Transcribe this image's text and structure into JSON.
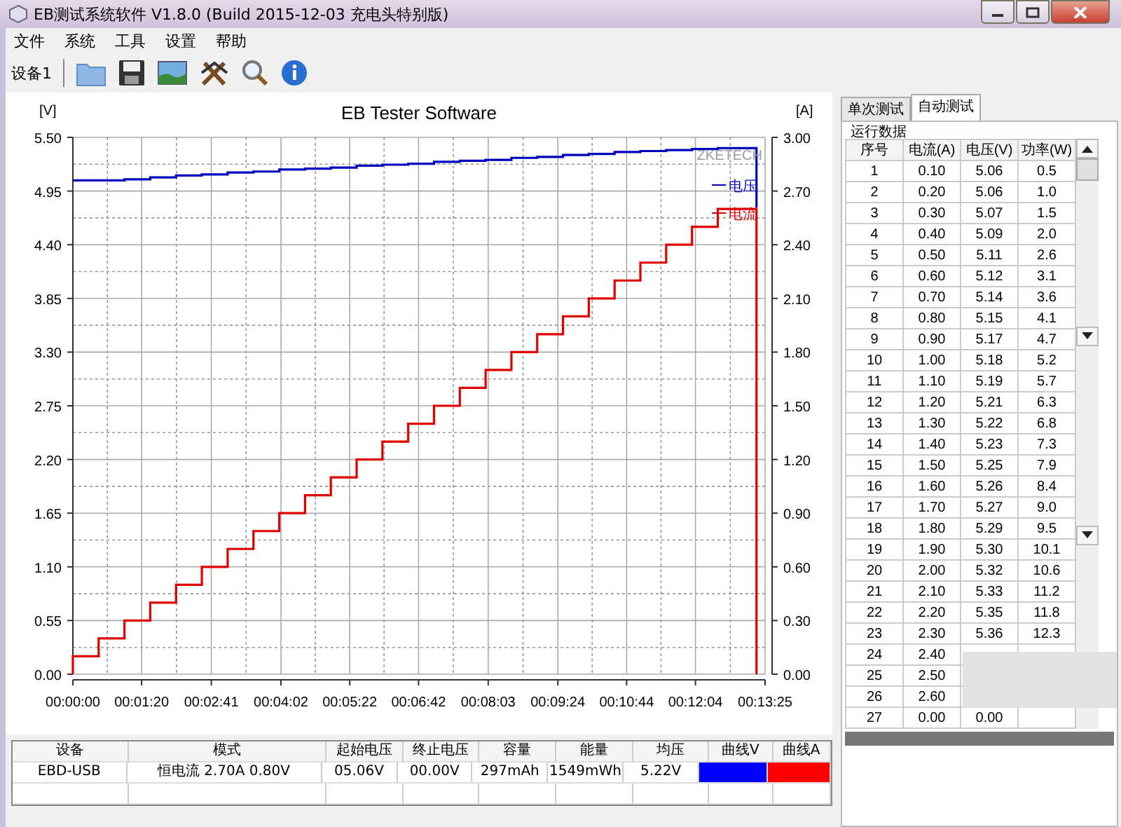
{
  "window": {
    "title": "EB测试系统软件 V1.8.0 (Build 2015-12-03 充电头特别版)"
  },
  "menu": [
    "文件",
    "系统",
    "工具",
    "设置",
    "帮助"
  ],
  "toolbar": {
    "device_label": "设备1"
  },
  "chart": {
    "chart_data": {
      "type": "line",
      "title": "EB Tester Software",
      "ylabel": "[V]",
      "y2label": "[A]",
      "annotations": [
        {
          "text": "ZKETECH"
        }
      ],
      "grid": true,
      "legend": "upper right",
      "x": [
        0,
        0,
        30,
        30,
        60,
        60,
        90,
        90,
        120,
        120,
        150,
        150,
        180,
        180,
        210,
        210,
        240,
        240,
        270,
        270,
        300,
        300,
        330,
        330,
        360,
        360,
        390,
        390,
        420,
        420,
        450,
        450,
        480,
        480,
        510,
        510,
        540,
        540,
        570,
        570,
        600,
        600,
        630,
        630,
        660,
        660,
        690,
        690,
        720,
        720,
        750,
        750,
        795,
        795
      ],
      "series": [
        {
          "name": "电压",
          "color": "#0000c0",
          "values": [
            5.06,
            5.06,
            5.06,
            5.06,
            5.06,
            5.07,
            5.07,
            5.09,
            5.09,
            5.11,
            5.11,
            5.12,
            5.12,
            5.14,
            5.14,
            5.15,
            5.15,
            5.17,
            5.17,
            5.18,
            5.18,
            5.19,
            5.19,
            5.21,
            5.21,
            5.22,
            5.22,
            5.23,
            5.23,
            5.25,
            5.25,
            5.26,
            5.26,
            5.27,
            5.27,
            5.29,
            5.29,
            5.3,
            5.3,
            5.32,
            5.32,
            5.33,
            5.33,
            5.35,
            5.35,
            5.36,
            5.36,
            5.37,
            5.37,
            5.38,
            5.38,
            5.39,
            5.39,
            4.78
          ]
        },
        {
          "name": "电流",
          "color": "#e00000",
          "axis": "y2",
          "values": [
            0,
            0.1,
            0.1,
            0.2,
            0.2,
            0.3,
            0.3,
            0.4,
            0.4,
            0.5,
            0.5,
            0.6,
            0.6,
            0.7,
            0.7,
            0.8,
            0.8,
            0.9,
            0.9,
            1.0,
            1.0,
            1.1,
            1.1,
            1.2,
            1.2,
            1.3,
            1.3,
            1.4,
            1.4,
            1.5,
            1.5,
            1.6,
            1.6,
            1.7,
            1.7,
            1.8,
            1.8,
            1.9,
            1.9,
            2.0,
            2.0,
            2.1,
            2.1,
            2.2,
            2.2,
            2.3,
            2.3,
            2.4,
            2.4,
            2.5,
            2.5,
            2.6,
            2.6,
            0
          ]
        }
      ],
      "xlim": [
        0,
        805
      ],
      "ylim": [
        0,
        5.5
      ],
      "y2lim": [
        0,
        3
      ],
      "xticks": [
        {
          "value": 0,
          "label": "00:00:00"
        },
        {
          "value": 80,
          "label": "00:01:20"
        },
        {
          "value": 161,
          "label": "00:02:41"
        },
        {
          "value": 242,
          "label": "00:04:02"
        },
        {
          "value": 322,
          "label": "00:05:22"
        },
        {
          "value": 402,
          "label": "00:06:42"
        },
        {
          "value": 483,
          "label": "00:08:03"
        },
        {
          "value": 564,
          "label": "00:09:24"
        },
        {
          "value": 644,
          "label": "00:10:44"
        },
        {
          "value": 724,
          "label": "00:12:04"
        },
        {
          "value": 805,
          "label": "00:13:25"
        }
      ],
      "yticks": [
        {
          "value": 0,
          "label": "0.00"
        },
        {
          "value": 0.55,
          "label": "0.55"
        },
        {
          "value": 1.1,
          "label": "1.10"
        },
        {
          "value": 1.65,
          "label": "1.65"
        },
        {
          "value": 2.2,
          "label": "2.20"
        },
        {
          "value": 2.75,
          "label": "2.75"
        },
        {
          "value": 3.3,
          "label": "3.30"
        },
        {
          "value": 3.85,
          "label": "3.85"
        },
        {
          "value": 4.4,
          "label": "4.40"
        },
        {
          "value": 4.95,
          "label": "4.95"
        },
        {
          "value": 5.5,
          "label": "5.50"
        }
      ],
      "y2ticks": [
        {
          "value": 0,
          "label": "0.00"
        },
        {
          "value": 0.3,
          "label": "0.30"
        },
        {
          "value": 0.6,
          "label": "0.60"
        },
        {
          "value": 0.9,
          "label": "0.90"
        },
        {
          "value": 1.2,
          "label": "1.20"
        },
        {
          "value": 1.5,
          "label": "1.50"
        },
        {
          "value": 1.8,
          "label": "1.80"
        },
        {
          "value": 2.1,
          "label": "2.10"
        },
        {
          "value": 2.4,
          "label": "2.40"
        },
        {
          "value": 2.7,
          "label": "2.70"
        },
        {
          "value": 3.0,
          "label": "3.00"
        }
      ]
    }
  },
  "summary": {
    "columns": [
      "设备",
      "模式",
      "起始电压",
      "终止电压",
      "容量",
      "能量",
      "均压",
      "曲线V",
      "曲线A"
    ],
    "row": {
      "device": "EBD-USB",
      "mode": "恒电流  2.70A  0.80V",
      "start_voltage": "05.06V",
      "end_voltage": "00.00V",
      "capacity": "297mAh",
      "energy": "1549mWh",
      "avg_voltage": "5.22V"
    },
    "curves": [
      {
        "color": "#0000ff"
      },
      {
        "color": "#ff0000"
      }
    ]
  },
  "side_panel": {
    "tabs": [
      {
        "label": "单次测试",
        "selected": false
      },
      {
        "label": "自动测试",
        "selected": true
      }
    ],
    "group_title": "运行数据",
    "columns": [
      "序号",
      "电流(A)",
      "电压(V)",
      "功率(W)"
    ],
    "rows": [
      [
        "1",
        "0.10",
        "5.06",
        "0.5"
      ],
      [
        "2",
        "0.20",
        "5.06",
        "1.0"
      ],
      [
        "3",
        "0.30",
        "5.07",
        "1.5"
      ],
      [
        "4",
        "0.40",
        "5.09",
        "2.0"
      ],
      [
        "5",
        "0.50",
        "5.11",
        "2.6"
      ],
      [
        "6",
        "0.60",
        "5.12",
        "3.1"
      ],
      [
        "7",
        "0.70",
        "5.14",
        "3.6"
      ],
      [
        "8",
        "0.80",
        "5.15",
        "4.1"
      ],
      [
        "9",
        "0.90",
        "5.17",
        "4.7"
      ],
      [
        "10",
        "1.00",
        "5.18",
        "5.2"
      ],
      [
        "11",
        "1.10",
        "5.19",
        "5.7"
      ],
      [
        "12",
        "1.20",
        "5.21",
        "6.3"
      ],
      [
        "13",
        "1.30",
        "5.22",
        "6.8"
      ],
      [
        "14",
        "1.40",
        "5.23",
        "7.3"
      ],
      [
        "15",
        "1.50",
        "5.25",
        "7.9"
      ],
      [
        "16",
        "1.60",
        "5.26",
        "8.4"
      ],
      [
        "17",
        "1.70",
        "5.27",
        "9.0"
      ],
      [
        "18",
        "1.80",
        "5.29",
        "9.5"
      ],
      [
        "19",
        "1.90",
        "5.30",
        "10.1"
      ],
      [
        "20",
        "2.00",
        "5.32",
        "10.6"
      ],
      [
        "21",
        "2.10",
        "5.33",
        "11.2"
      ],
      [
        "22",
        "2.20",
        "5.35",
        "11.8"
      ],
      [
        "23",
        "2.30",
        "5.36",
        "12.3"
      ],
      [
        "24",
        "2.40"
      ],
      [
        "25",
        "2.50"
      ],
      [
        "26",
        "2.60"
      ],
      [
        "27",
        "0.00",
        "0.00"
      ]
    ]
  }
}
